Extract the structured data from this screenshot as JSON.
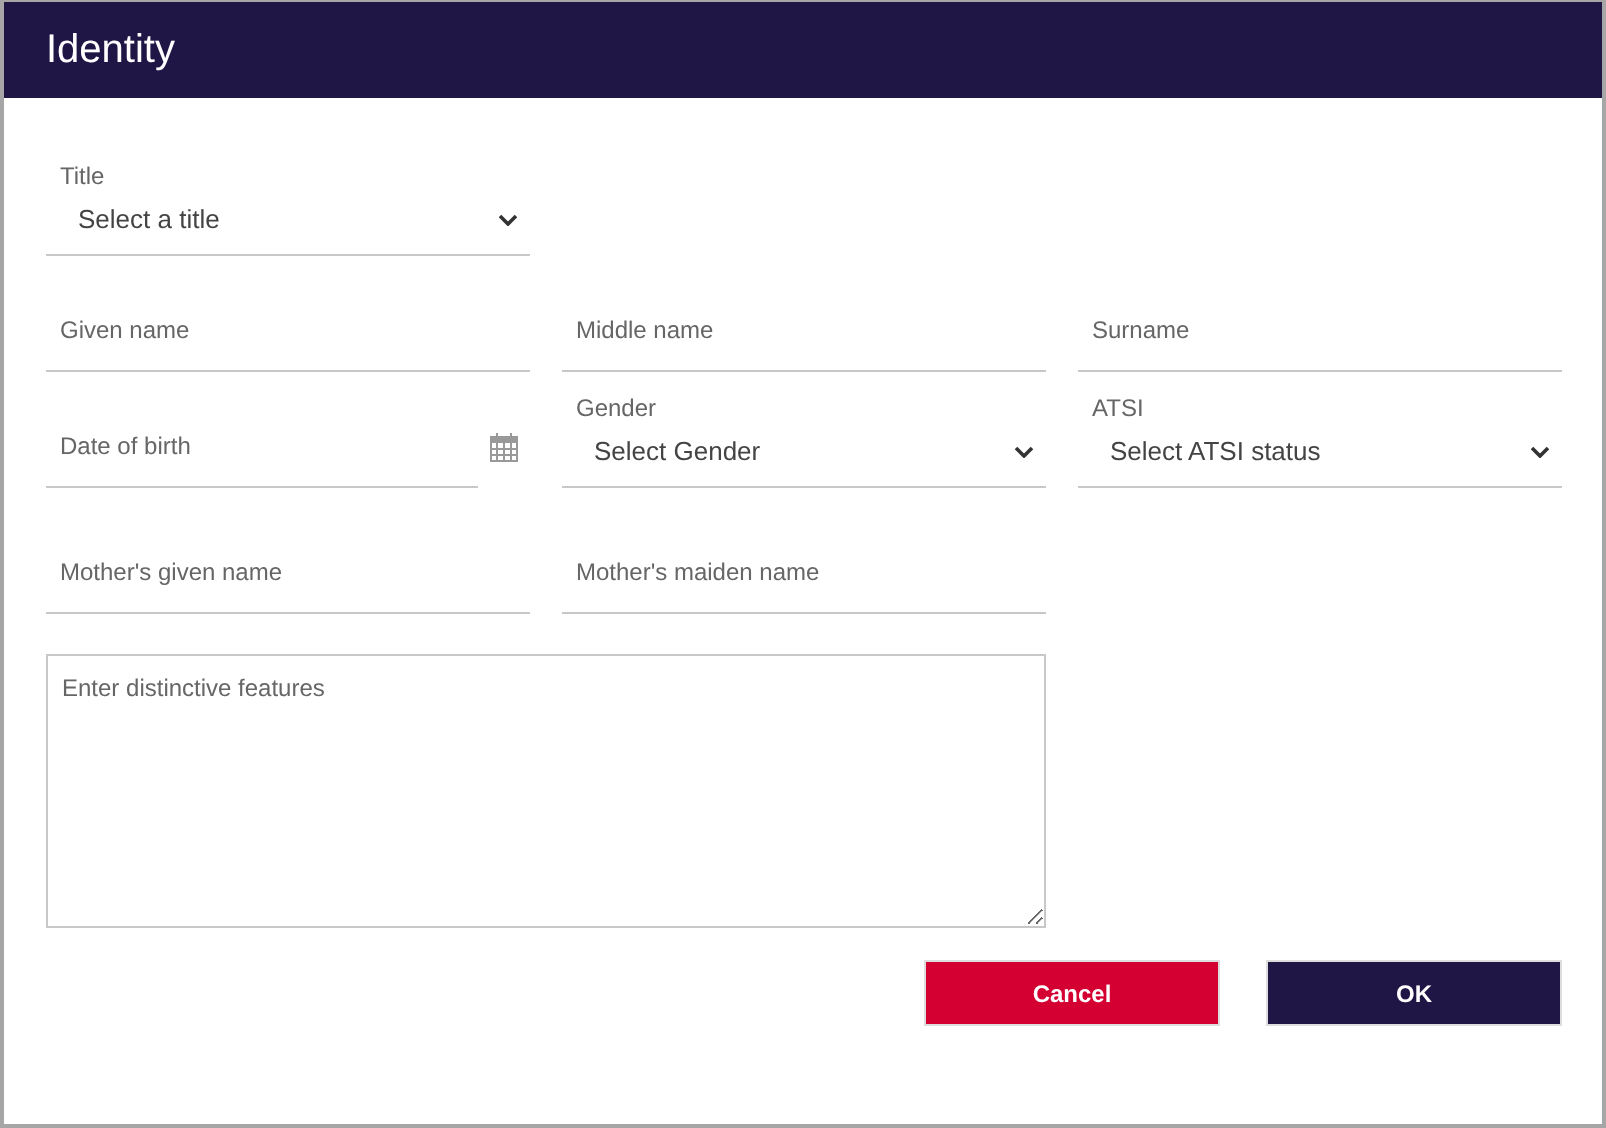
{
  "window": {
    "title": "Identity"
  },
  "rows": [
    [
      {
        "kind": "select",
        "label": "Title",
        "value": "Select a title"
      }
    ],
    [
      {
        "kind": "text",
        "placeholder": "Given name"
      },
      {
        "kind": "text",
        "placeholder": "Middle name"
      },
      {
        "kind": "text",
        "placeholder": "Surname"
      }
    ],
    [
      {
        "kind": "date",
        "placeholder": "Date of birth"
      },
      {
        "kind": "select",
        "label": "Gender",
        "value": "Select Gender"
      },
      {
        "kind": "select",
        "label": "ATSI",
        "value": "Select ATSI status"
      }
    ],
    [
      {
        "kind": "text",
        "placeholder": "Mother's given name"
      },
      {
        "kind": "text",
        "placeholder": "Mother's maiden name"
      }
    ]
  ],
  "features": {
    "placeholder": "Enter distinctive features"
  },
  "buttons": [
    {
      "kind": "cancel",
      "label": "Cancel"
    },
    {
      "kind": "ok",
      "label": "OK"
    }
  ]
}
